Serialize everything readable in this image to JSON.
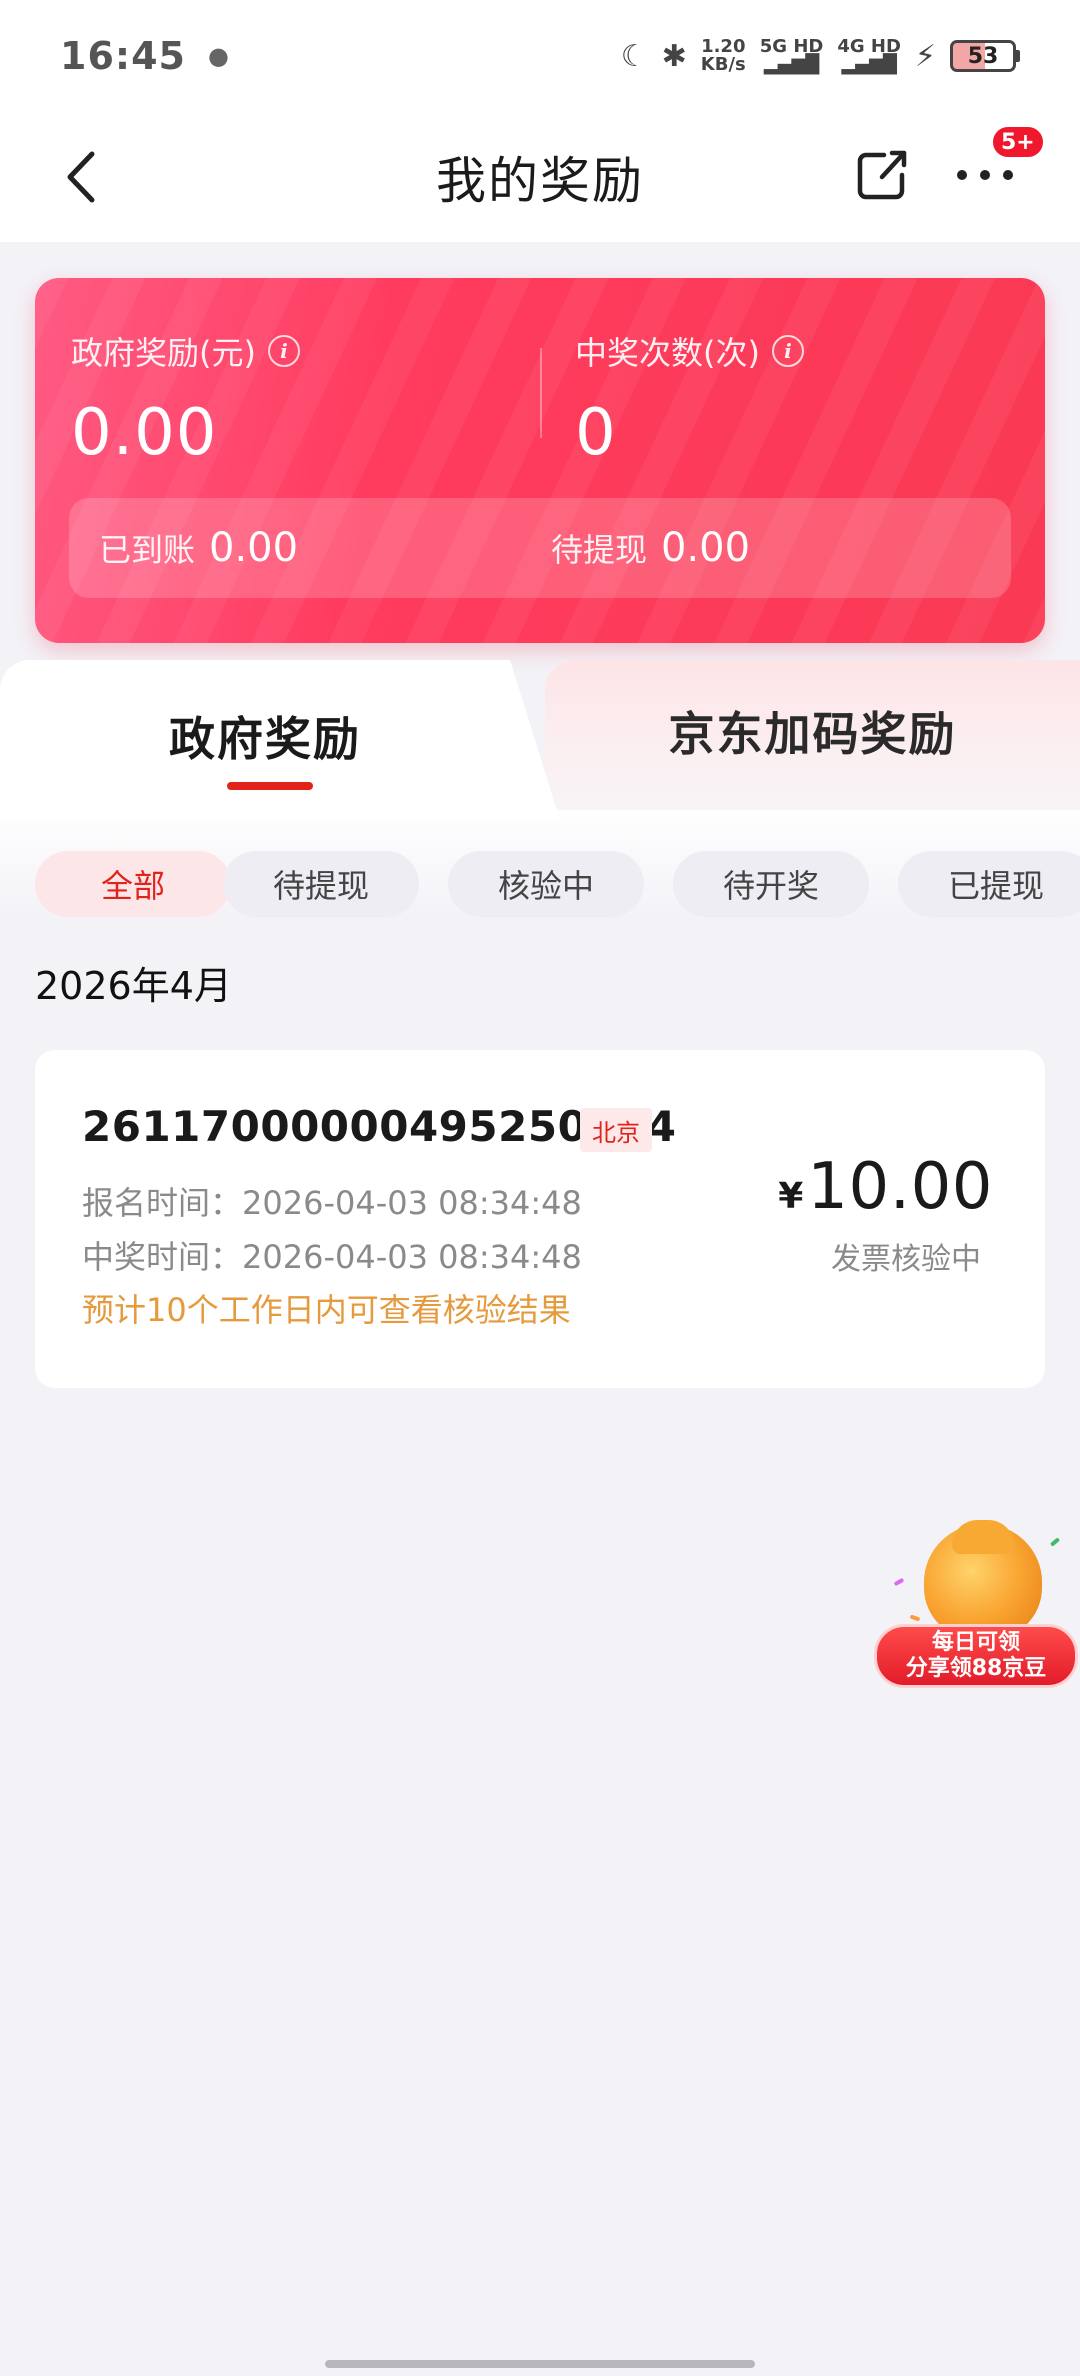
{
  "status_bar": {
    "time": "16:45",
    "net_speed_value": "1.20",
    "net_speed_unit": "KB/s",
    "sim1": "5G HD",
    "sim2": "4G HD",
    "battery": "53"
  },
  "header": {
    "title": "我的奖励",
    "more_badge": "5+"
  },
  "summary": {
    "gov_label": "政府奖励(元)",
    "gov_value": "0.00",
    "win_label": "中奖次数(次)",
    "win_value": "0",
    "arrived_label": "已到账",
    "arrived_value": "0.00",
    "pending_label": "待提现",
    "pending_value": "0.00",
    "info_glyph": "i"
  },
  "tabs": {
    "gov": "政府奖励",
    "jd": "京东加码奖励"
  },
  "filters": [
    {
      "label": "全部",
      "active": true
    },
    {
      "label": "待提现",
      "active": false
    },
    {
      "label": "核验中",
      "active": false
    },
    {
      "label": "待开奖",
      "active": false
    },
    {
      "label": "已提现",
      "active": false
    }
  ],
  "month": "2026年4月",
  "record": {
    "id": "26117000000495250724",
    "region": "北京",
    "signup_label": "报名时间：",
    "signup_time": "2026-04-03 08:34:48",
    "win_label": "中奖时间：",
    "win_time": "2026-04-03 08:34:48",
    "note": "预计10个工作日内可查看核验结果",
    "currency": "¥",
    "amount": "10.00",
    "status": "发票核验中"
  },
  "promo": {
    "line1": "每日可领",
    "line2": "分享领88京豆"
  },
  "colors": {
    "accent": "#e2231a",
    "card_gradient_start": "#ff5a83",
    "card_gradient_end": "#fa3a54",
    "note": "#e59a3e"
  }
}
